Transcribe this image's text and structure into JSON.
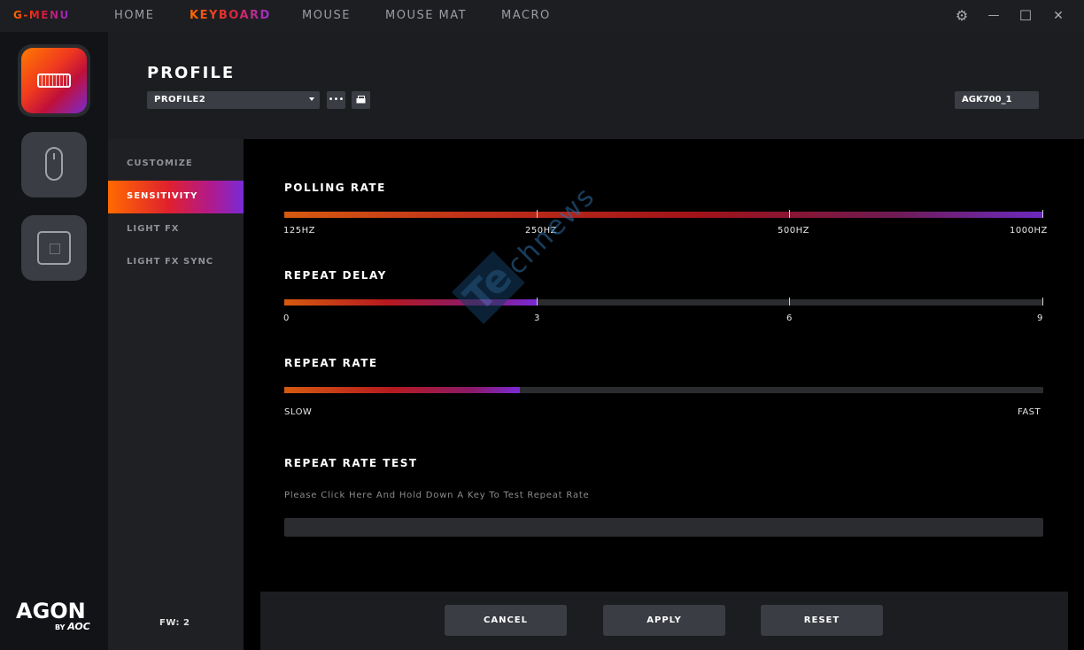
{
  "app": {
    "logo": "G-MENU"
  },
  "nav": {
    "home": "HOME",
    "keyboard": "KEYBOARD",
    "mouse": "MOUSE",
    "mouse_mat": "MOUSE MAT",
    "macro": "MACRO"
  },
  "window": {
    "settings_icon": "⚙",
    "minimize_icon": "—",
    "maximize_icon": "☐",
    "close_icon": "✕"
  },
  "devices": [
    "keyboard",
    "mouse",
    "mouse-mat"
  ],
  "brand": {
    "agon": "AGON",
    "by": "BY",
    "aoc": "AOC"
  },
  "header": {
    "title": "PROFILE",
    "profile_select": "PROFILE2",
    "more_button": "•••",
    "device_name": "AGK700_1"
  },
  "submenu": {
    "customize": "CUSTOMIZE",
    "sensitivity": "SENSITIVITY",
    "light_fx": "LIGHT FX",
    "light_fx_sync": "LIGHT FX SYNC"
  },
  "firmware": "FW: 2",
  "polling_rate": {
    "title": "POLLING RATE",
    "labels": [
      "125HZ",
      "250HZ",
      "500HZ",
      "1000HZ"
    ],
    "selected": "1000HZ",
    "fill_fraction": 1.0
  },
  "repeat_delay": {
    "title": "REPEAT DELAY",
    "labels": [
      "0",
      "3",
      "6",
      "9"
    ],
    "value": 3,
    "fill_fraction": 0.333
  },
  "repeat_rate": {
    "title": "REPEAT RATE",
    "min_label": "SLOW",
    "max_label": "FAST",
    "fill_fraction": 0.31
  },
  "repeat_rate_test": {
    "title": "REPEAT RATE TEST",
    "hint": "Please Click Here And Hold Down A Key To Test Repeat Rate",
    "value": ""
  },
  "footer": {
    "cancel": "CANCEL",
    "apply": "APPLY",
    "reset": "RESET"
  },
  "watermark": {
    "te": "Te",
    "rest": "chnews"
  },
  "colors": {
    "accent_orange": "#ff6a00",
    "accent_red": "#e0202e",
    "accent_purple": "#7a2ad6"
  }
}
